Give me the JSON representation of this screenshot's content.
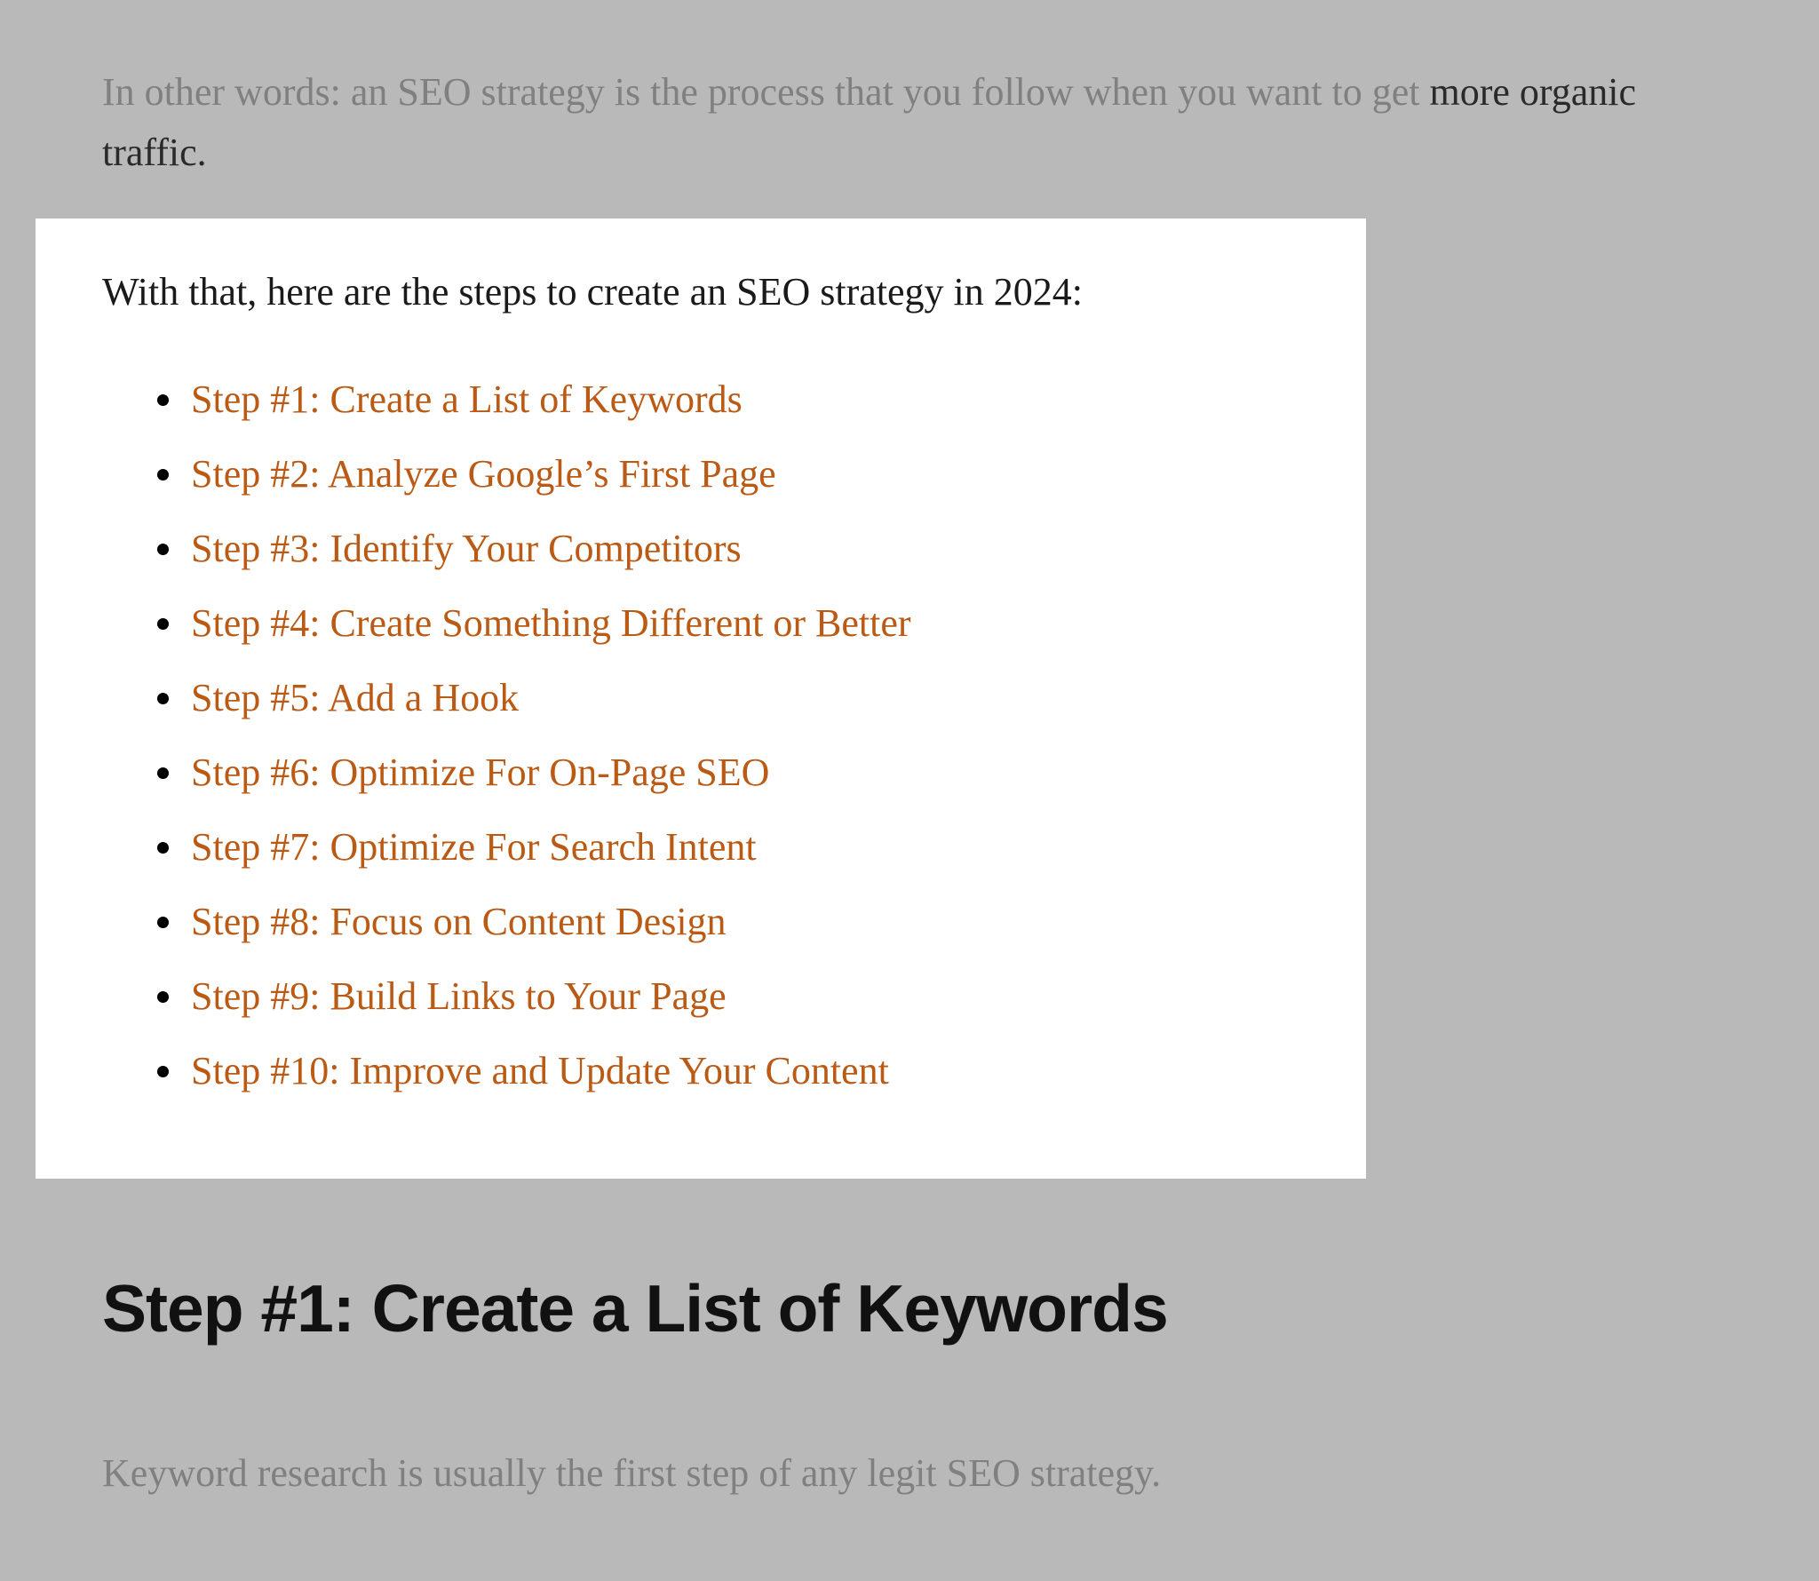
{
  "intro": {
    "part1": "In other words: an SEO strategy is the process that you follow when you want to get ",
    "part2": "more organic traffic."
  },
  "lead_in": "With that, here are the steps to create an SEO strategy in 2024:",
  "steps": [
    "Step #1: Create a List of Keywords",
    "Step #2: Analyze Google’s First Page",
    "Step #3: Identify Your Competitors",
    "Step #4: Create Something Different or Better",
    "Step #5: Add a Hook",
    "Step #6: Optimize For On-Page SEO",
    "Step #7: Optimize For Search Intent",
    "Step #8: Focus on Content Design",
    "Step #9: Build Links to Your Page",
    "Step #10: Improve and Update Your Content"
  ],
  "section_heading": "Step #1: Create a List of Keywords",
  "body_text": "Keyword research is usually the first step of any legit SEO strategy."
}
